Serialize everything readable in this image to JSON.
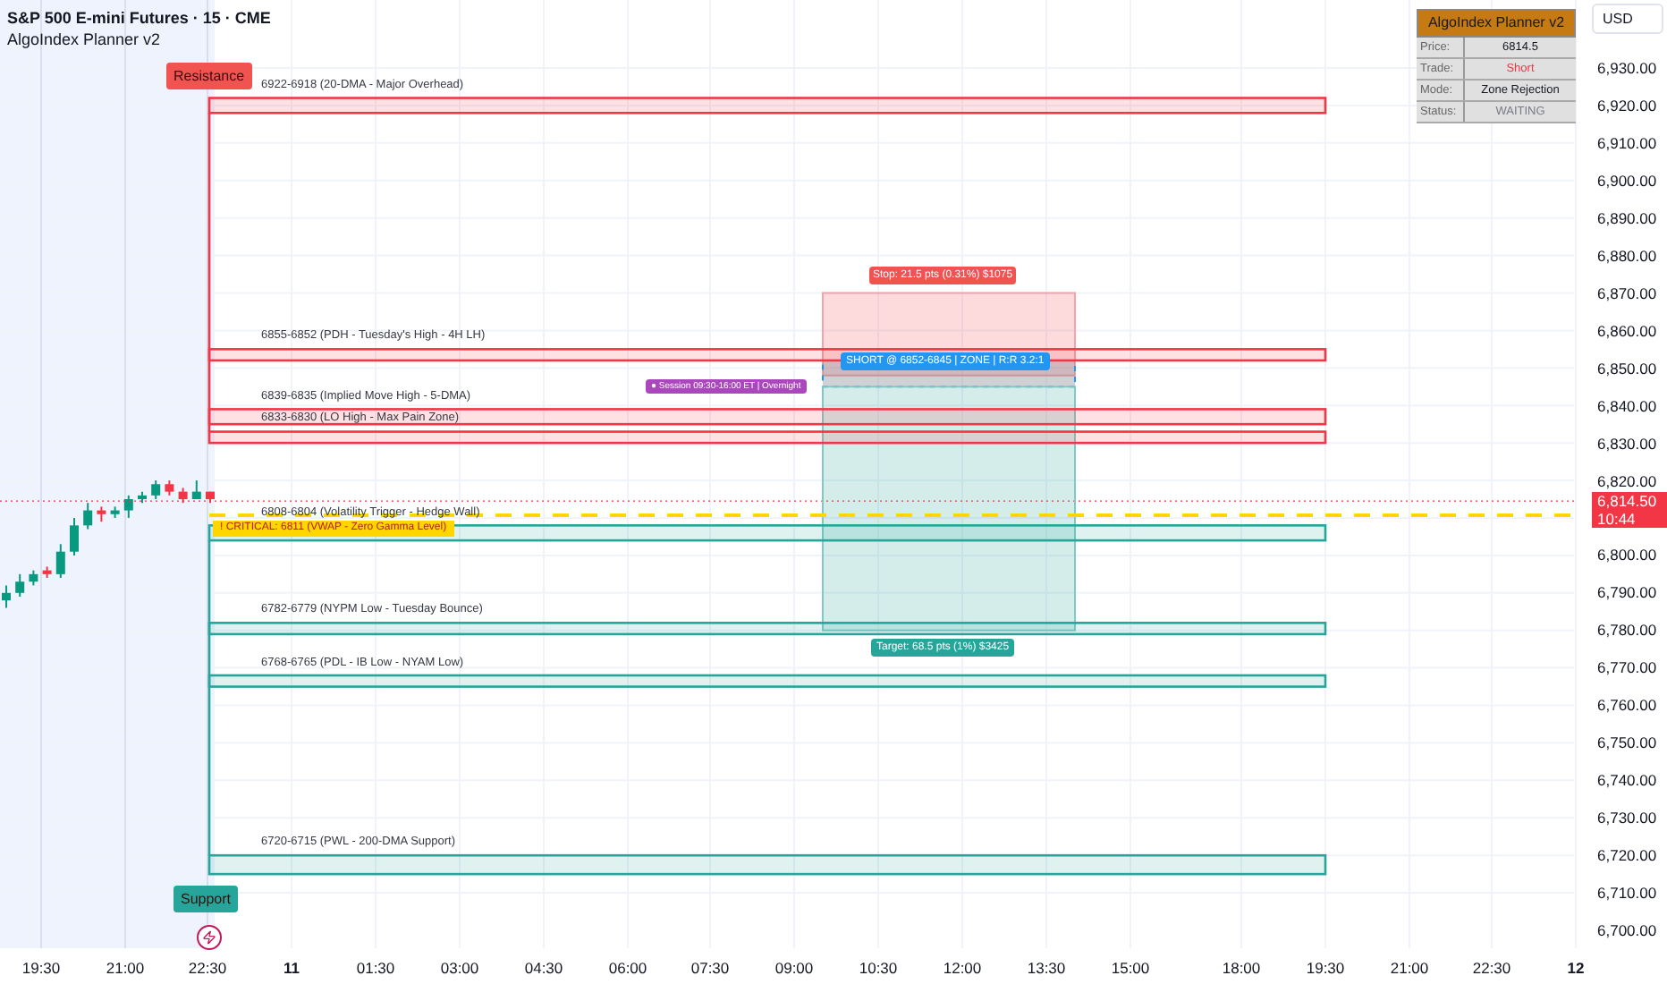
{
  "header": {
    "symbol": "S&P 500 E-mini Futures · 15 · CME",
    "indicator": "AlgoIndex Planner v2"
  },
  "currency_button": "USD",
  "info_table": {
    "title": "AlgoIndex Planner v2",
    "rows": [
      {
        "label": "Price:",
        "value": "6814.5",
        "color": "#131722"
      },
      {
        "label": "Trade:",
        "value": "Short",
        "color": "#f23645"
      },
      {
        "label": "Mode:",
        "value": "Zone Rejection",
        "color": "#131722"
      },
      {
        "label": "Status:",
        "value": "WAITING",
        "color": "#787b86"
      }
    ]
  },
  "group_labels": [
    {
      "text": "Resistance",
      "kind": "resistance"
    },
    {
      "text": "Support",
      "kind": "support"
    }
  ],
  "zones": [
    {
      "label": "6922-6918 (20-DMA - Major Overhead)",
      "kind": "resistance"
    },
    {
      "label": "6855-6852 (PDH - Tuesday's High - 4H LH)",
      "kind": "resistance"
    },
    {
      "label": "6839-6835 (Implied Move High - 5-DMA)",
      "kind": "resistance"
    },
    {
      "label": "6833-6830 (LO High - Max Pain Zone)",
      "kind": "resistance"
    },
    {
      "label": "6808-6804 (Volatility Trigger - Hedge Wall)",
      "kind": "support"
    },
    {
      "label": "6782-6779 (NYPM Low - Tuesday Bounce)",
      "kind": "support"
    },
    {
      "label": "6768-6765 (PDL - IB Low - NYAM Low)",
      "kind": "support"
    },
    {
      "label": "6720-6715 (PWL - 200-DMA Support)",
      "kind": "support"
    }
  ],
  "critical_label": "! CRITICAL: 6811 (VWAP - Zero Gamma Level)",
  "session_label": "● Session 09:30-16:00 ET | Overnight",
  "position": {
    "stop_label": "Stop: 21.5 pts (0.31%) $1075",
    "entry_label": "SHORT @ 6852-6845 | ZONE | R:R 3.2:1",
    "target_label": "Target: 68.5 pts (1%) $3425"
  },
  "price_axis": [
    "6,930.00",
    "6,920.00",
    "6,910.00",
    "6,900.00",
    "6,890.00",
    "6,880.00",
    "6,870.00",
    "6,860.00",
    "6,850.00",
    "6,840.00",
    "6,830.00",
    "6,820.00",
    "6,800.00",
    "6,790.00",
    "6,780.00",
    "6,770.00",
    "6,760.00",
    "6,750.00",
    "6,740.00",
    "6,730.00",
    "6,720.00",
    "6,710.00",
    "6,700.00"
  ],
  "last_price": {
    "price": "6,814.50",
    "countdown": "10:44"
  },
  "time_axis": [
    {
      "label": "19:30",
      "bold": false
    },
    {
      "label": "21:00",
      "bold": false
    },
    {
      "label": "22:30",
      "bold": false
    },
    {
      "label": "11",
      "bold": true
    },
    {
      "label": "01:30",
      "bold": false
    },
    {
      "label": "03:00",
      "bold": false
    },
    {
      "label": "04:30",
      "bold": false
    },
    {
      "label": "06:00",
      "bold": false
    },
    {
      "label": "07:30",
      "bold": false
    },
    {
      "label": "09:00",
      "bold": false
    },
    {
      "label": "10:30",
      "bold": false
    },
    {
      "label": "12:00",
      "bold": false
    },
    {
      "label": "13:30",
      "bold": false
    },
    {
      "label": "15:00",
      "bold": false
    },
    {
      "label": "18:00",
      "bold": false
    },
    {
      "label": "19:30",
      "bold": false
    },
    {
      "label": "21:00",
      "bold": false
    },
    {
      "label": "22:30",
      "bold": false
    },
    {
      "label": "12",
      "bold": true
    }
  ]
}
